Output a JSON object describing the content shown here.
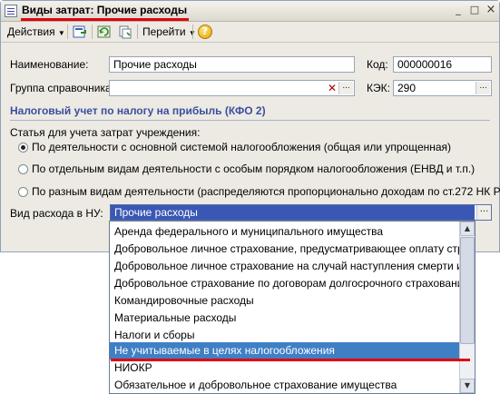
{
  "window": {
    "title": "Виды затрат: Прочие расходы",
    "title_buttons": [
      "_",
      "□",
      "×"
    ]
  },
  "toolbar": {
    "actions_label": "Действия",
    "goto_label": "Перейти",
    "help_glyph": "?"
  },
  "form": {
    "name_label": "Наименование:",
    "name_value": "Прочие расходы",
    "code_label": "Код:",
    "code_value": "000000016",
    "group_label": "Группа справочника:",
    "group_value": "",
    "kek_label": "КЭК:",
    "kek_value": "290",
    "dots": "..."
  },
  "tax_section": {
    "title": "Налоговый учет по налогу на прибыль (КФО 2)",
    "article_label": "Статья для учета затрат учреждения:",
    "options": [
      {
        "label": "По деятельности с основной системой налогообложения (общая или упрощенная)",
        "checked": true
      },
      {
        "label": "По отдельным видам деятельности с особым порядком налогообложения (ЕНВД и т.п.)",
        "checked": false
      },
      {
        "label": "По разным видам деятельности (распределяются пропорционально доходам по ст.272 НК РФ)",
        "checked": false
      }
    ],
    "expense_type_label": "Вид расхода в НУ:",
    "expense_type_value": "Прочие расходы"
  },
  "dropdown": {
    "items": [
      "Аренда федерального и муниципального имущества",
      "Добровольное личное страхование, предусматривающее оплату страховщ...",
      "Добровольное личное страхование на случай наступления смерти или утр...",
      "Добровольное страхование по договорам долгосрочного страхования жиз...",
      "Командировочные расходы",
      "Материальные расходы",
      "Налоги и сборы",
      "Не учитываемые в целях налогообложения",
      "НИОКР",
      "Обязательное и добровольное страхование имущества"
    ],
    "selected_index": 7
  },
  "colors": {
    "accent": "#3b57b5",
    "selected_row": "#3f80c5",
    "section_title": "#3a4fa0",
    "highlight_mark": "#e00010"
  }
}
